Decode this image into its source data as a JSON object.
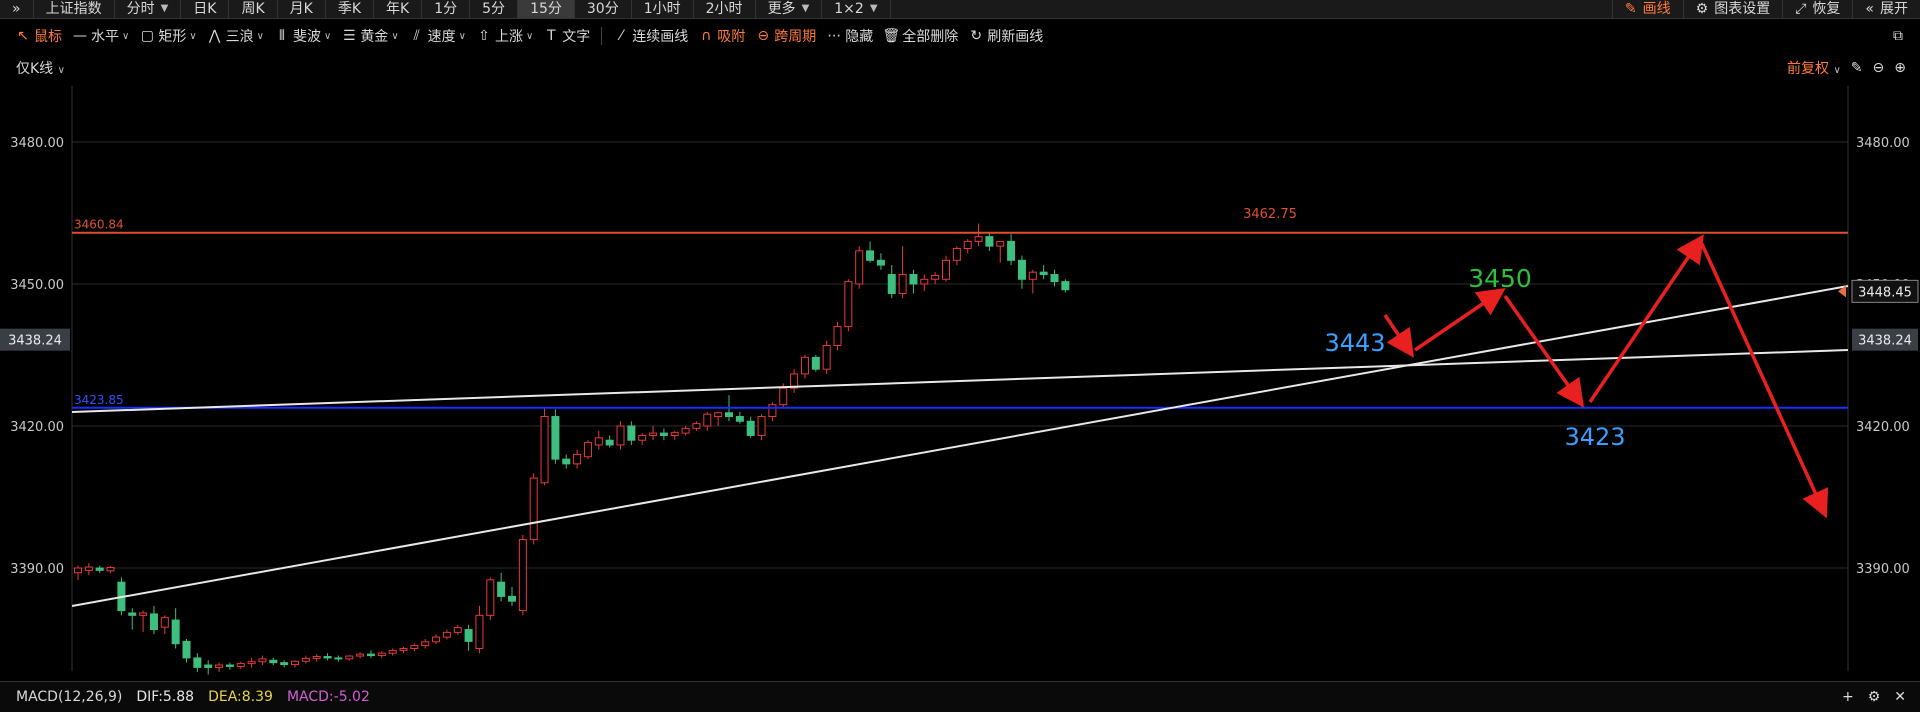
{
  "topbar": {
    "items": [
      "上证指数",
      "分时",
      "日K",
      "周K",
      "月K",
      "季K",
      "年K",
      "1分",
      "5分",
      "15分",
      "30分",
      "1小时",
      "2小时",
      "更多",
      "1×2"
    ],
    "active_index": 9,
    "right": [
      "画线",
      "图表设置",
      "恢复",
      "展开"
    ]
  },
  "toolbar": {
    "items": [
      "鼠标",
      "水平",
      "矩形",
      "三浪",
      "斐波",
      "黄金",
      "速度",
      "上涨",
      "文字",
      "连续画线",
      "吸附",
      "跨周期",
      "隐藏",
      "全部删除",
      "刷新画线"
    ]
  },
  "subbar": {
    "indicator": "仅K线",
    "adjust": "前复权"
  },
  "chart_data": {
    "type": "candlestick",
    "y_ticks": [
      "3480.00",
      "3450.00",
      "3420.00",
      "3390.00"
    ],
    "crosshair_price": "3438.24",
    "last_price": "3448.45",
    "high_label": "3462.75",
    "line_labels": [
      "3460.84",
      "3423.85"
    ],
    "annotations": [
      "3443",
      "3450",
      "3423"
    ],
    "colors": {
      "up": "#e8393a",
      "down": "#3fbf7f",
      "hline_top": "#e0502f",
      "hline_blue": "#1830ff",
      "arrow": "#e82020",
      "ann_blue": "#3aa0ff",
      "ann_green": "#2fbf3f"
    },
    "candles": [
      {
        "o": 3389.0,
        "h": 3390.5,
        "l": 3387.5,
        "c": 3390.0
      },
      {
        "o": 3389.5,
        "h": 3391.0,
        "l": 3388.5,
        "c": 3390.2
      },
      {
        "o": 3390.0,
        "h": 3390.5,
        "l": 3389.0,
        "c": 3389.5
      },
      {
        "o": 3389.4,
        "h": 3390.4,
        "l": 3388.9,
        "c": 3390.1
      },
      {
        "o": 3387.0,
        "h": 3388.0,
        "l": 3380.0,
        "c": 3381.0
      },
      {
        "o": 3380.5,
        "h": 3381.5,
        "l": 3377.0,
        "c": 3380.0
      },
      {
        "o": 3380.0,
        "h": 3381.0,
        "l": 3376.5,
        "c": 3380.5
      },
      {
        "o": 3380.3,
        "h": 3382.0,
        "l": 3376.0,
        "c": 3377.0
      },
      {
        "o": 3377.5,
        "h": 3380.0,
        "l": 3376.0,
        "c": 3379.5
      },
      {
        "o": 3379.0,
        "h": 3381.5,
        "l": 3373.0,
        "c": 3374.0
      },
      {
        "o": 3374.5,
        "h": 3375.0,
        "l": 3370.0,
        "c": 3371.0
      },
      {
        "o": 3371.0,
        "h": 3372.0,
        "l": 3368.0,
        "c": 3369.0
      },
      {
        "o": 3369.5,
        "h": 3370.5,
        "l": 3367.5,
        "c": 3369.0
      },
      {
        "o": 3369.0,
        "h": 3370.0,
        "l": 3368.0,
        "c": 3369.5
      },
      {
        "o": 3369.5,
        "h": 3370.0,
        "l": 3368.5,
        "c": 3369.2
      },
      {
        "o": 3369.2,
        "h": 3370.2,
        "l": 3368.7,
        "c": 3369.8
      },
      {
        "o": 3369.8,
        "h": 3371.0,
        "l": 3369.0,
        "c": 3370.2
      },
      {
        "o": 3370.2,
        "h": 3371.5,
        "l": 3369.5,
        "c": 3370.8
      },
      {
        "o": 3370.5,
        "h": 3371.0,
        "l": 3369.5,
        "c": 3370.0
      },
      {
        "o": 3370.0,
        "h": 3370.5,
        "l": 3369.0,
        "c": 3369.6
      },
      {
        "o": 3369.6,
        "h": 3370.5,
        "l": 3369.0,
        "c": 3370.3
      },
      {
        "o": 3370.3,
        "h": 3371.5,
        "l": 3369.8,
        "c": 3370.9
      },
      {
        "o": 3370.9,
        "h": 3371.8,
        "l": 3370.2,
        "c": 3371.3
      },
      {
        "o": 3371.3,
        "h": 3372.0,
        "l": 3370.5,
        "c": 3371.0
      },
      {
        "o": 3371.0,
        "h": 3371.5,
        "l": 3370.2,
        "c": 3370.8
      },
      {
        "o": 3370.8,
        "h": 3371.6,
        "l": 3370.4,
        "c": 3371.4
      },
      {
        "o": 3371.4,
        "h": 3372.2,
        "l": 3370.9,
        "c": 3371.8
      },
      {
        "o": 3371.8,
        "h": 3372.6,
        "l": 3371.0,
        "c": 3371.5
      },
      {
        "o": 3371.5,
        "h": 3372.4,
        "l": 3371.0,
        "c": 3372.0
      },
      {
        "o": 3372.0,
        "h": 3373.0,
        "l": 3371.5,
        "c": 3372.6
      },
      {
        "o": 3372.6,
        "h": 3373.4,
        "l": 3372.0,
        "c": 3373.0
      },
      {
        "o": 3373.0,
        "h": 3374.0,
        "l": 3372.4,
        "c": 3373.6
      },
      {
        "o": 3373.6,
        "h": 3375.0,
        "l": 3373.0,
        "c": 3374.4
      },
      {
        "o": 3374.4,
        "h": 3376.0,
        "l": 3373.9,
        "c": 3375.4
      },
      {
        "o": 3375.4,
        "h": 3377.0,
        "l": 3374.9,
        "c": 3376.4
      },
      {
        "o": 3376.4,
        "h": 3378.0,
        "l": 3375.9,
        "c": 3377.4
      },
      {
        "o": 3377.0,
        "h": 3378.0,
        "l": 3372.5,
        "c": 3374.5
      },
      {
        "o": 3373.0,
        "h": 3382.0,
        "l": 3372.0,
        "c": 3380.0
      },
      {
        "o": 3380.0,
        "h": 3388.0,
        "l": 3379.0,
        "c": 3387.5
      },
      {
        "o": 3387.0,
        "h": 3389.0,
        "l": 3383.0,
        "c": 3384.0
      },
      {
        "o": 3384.0,
        "h": 3386.0,
        "l": 3382.0,
        "c": 3383.0
      },
      {
        "o": 3381.0,
        "h": 3397.0,
        "l": 3380.0,
        "c": 3396.0
      },
      {
        "o": 3396.0,
        "h": 3410.0,
        "l": 3395.0,
        "c": 3409.0
      },
      {
        "o": 3408.0,
        "h": 3424.0,
        "l": 3407.5,
        "c": 3422.0
      },
      {
        "o": 3422.0,
        "h": 3423.5,
        "l": 3412.0,
        "c": 3413.0
      },
      {
        "o": 3413.0,
        "h": 3414.0,
        "l": 3411.0,
        "c": 3412.0
      },
      {
        "o": 3412.0,
        "h": 3415.0,
        "l": 3411.0,
        "c": 3414.0
      },
      {
        "o": 3413.5,
        "h": 3417.0,
        "l": 3413.0,
        "c": 3416.5
      },
      {
        "o": 3416.0,
        "h": 3419.0,
        "l": 3415.0,
        "c": 3417.5
      },
      {
        "o": 3417.0,
        "h": 3418.0,
        "l": 3415.5,
        "c": 3416.0
      },
      {
        "o": 3416.0,
        "h": 3421.0,
        "l": 3415.0,
        "c": 3420.0
      },
      {
        "o": 3420.0,
        "h": 3421.0,
        "l": 3416.0,
        "c": 3417.0
      },
      {
        "o": 3417.0,
        "h": 3418.5,
        "l": 3416.0,
        "c": 3418.0
      },
      {
        "o": 3418.0,
        "h": 3420.0,
        "l": 3417.0,
        "c": 3418.5
      },
      {
        "o": 3418.5,
        "h": 3419.5,
        "l": 3417.0,
        "c": 3418.0
      },
      {
        "o": 3418.0,
        "h": 3419.0,
        "l": 3417.0,
        "c": 3418.6
      },
      {
        "o": 3418.5,
        "h": 3420.0,
        "l": 3418.0,
        "c": 3419.5
      },
      {
        "o": 3419.5,
        "h": 3421.0,
        "l": 3419.0,
        "c": 3420.5
      },
      {
        "o": 3420.0,
        "h": 3423.0,
        "l": 3419.0,
        "c": 3422.5
      },
      {
        "o": 3422.0,
        "h": 3423.0,
        "l": 3420.0,
        "c": 3422.8
      },
      {
        "o": 3422.8,
        "h": 3426.5,
        "l": 3421.0,
        "c": 3422.0
      },
      {
        "o": 3422.0,
        "h": 3423.0,
        "l": 3420.5,
        "c": 3421.0
      },
      {
        "o": 3421.0,
        "h": 3422.0,
        "l": 3417.5,
        "c": 3418.0
      },
      {
        "o": 3418.0,
        "h": 3422.5,
        "l": 3417.0,
        "c": 3422.0
      },
      {
        "o": 3422.0,
        "h": 3425.0,
        "l": 3421.0,
        "c": 3424.5
      },
      {
        "o": 3424.5,
        "h": 3429.0,
        "l": 3424.0,
        "c": 3428.0
      },
      {
        "o": 3428.0,
        "h": 3432.0,
        "l": 3427.0,
        "c": 3431.0
      },
      {
        "o": 3431.0,
        "h": 3435.0,
        "l": 3430.0,
        "c": 3434.5
      },
      {
        "o": 3434.5,
        "h": 3435.0,
        "l": 3431.5,
        "c": 3432.0
      },
      {
        "o": 3432.0,
        "h": 3438.0,
        "l": 3431.0,
        "c": 3437.0
      },
      {
        "o": 3437.0,
        "h": 3442.0,
        "l": 3436.0,
        "c": 3441.0
      },
      {
        "o": 3441.0,
        "h": 3451.0,
        "l": 3440.0,
        "c": 3450.5
      },
      {
        "o": 3450.0,
        "h": 3458.0,
        "l": 3449.0,
        "c": 3457.0
      },
      {
        "o": 3457.0,
        "h": 3459.0,
        "l": 3454.5,
        "c": 3455.0
      },
      {
        "o": 3455.0,
        "h": 3456.5,
        "l": 3453.0,
        "c": 3454.0
      },
      {
        "o": 3452.0,
        "h": 3454.0,
        "l": 3447.0,
        "c": 3448.0
      },
      {
        "o": 3448.0,
        "h": 3458.0,
        "l": 3447.0,
        "c": 3452.0
      },
      {
        "o": 3452.0,
        "h": 3453.0,
        "l": 3448.0,
        "c": 3450.0
      },
      {
        "o": 3450.0,
        "h": 3452.0,
        "l": 3448.5,
        "c": 3451.0
      },
      {
        "o": 3451.0,
        "h": 3452.5,
        "l": 3450.0,
        "c": 3451.8
      },
      {
        "o": 3451.0,
        "h": 3456.0,
        "l": 3450.5,
        "c": 3455.0
      },
      {
        "o": 3455.0,
        "h": 3458.0,
        "l": 3454.0,
        "c": 3457.5
      },
      {
        "o": 3457.5,
        "h": 3459.5,
        "l": 3456.5,
        "c": 3459.0
      },
      {
        "o": 3459.0,
        "h": 3462.75,
        "l": 3458.0,
        "c": 3460.0
      },
      {
        "o": 3460.0,
        "h": 3461.0,
        "l": 3457.0,
        "c": 3458.0
      },
      {
        "o": 3458.0,
        "h": 3459.0,
        "l": 3454.5,
        "c": 3459.0
      },
      {
        "o": 3459.0,
        "h": 3460.5,
        "l": 3454.0,
        "c": 3455.0
      },
      {
        "o": 3455.0,
        "h": 3456.0,
        "l": 3449.0,
        "c": 3451.0
      },
      {
        "o": 3451.0,
        "h": 3453.0,
        "l": 3448.0,
        "c": 3452.5
      },
      {
        "o": 3452.5,
        "h": 3454.0,
        "l": 3451.0,
        "c": 3452.0
      },
      {
        "o": 3452.0,
        "h": 3453.0,
        "l": 3449.5,
        "c": 3450.5
      },
      {
        "o": 3450.5,
        "h": 3451.0,
        "l": 3448.2,
        "c": 3448.8
      }
    ]
  },
  "bottombar": {
    "macd_label": "MACD(12,26,9)",
    "dif": "DIF:5.88",
    "dea": "DEA:8.39",
    "macd": "MACD:-5.02"
  }
}
